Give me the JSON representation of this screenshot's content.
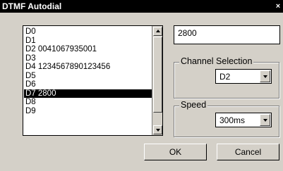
{
  "window": {
    "title": "DTMF Autodial",
    "close_glyph": "×"
  },
  "list": {
    "items": [
      "D0",
      "D1",
      "D2 0041067935001",
      "D3",
      "D4 1234567890123456",
      "D5",
      "D6",
      "D7 2800",
      "D8",
      "D9"
    ],
    "selected_index": 7
  },
  "number_field": {
    "value": "2800"
  },
  "channel": {
    "label": "Channel Selection",
    "value": "D2"
  },
  "speed": {
    "label": "Speed",
    "value": "300ms"
  },
  "buttons": {
    "ok": "OK",
    "cancel": "Cancel"
  }
}
